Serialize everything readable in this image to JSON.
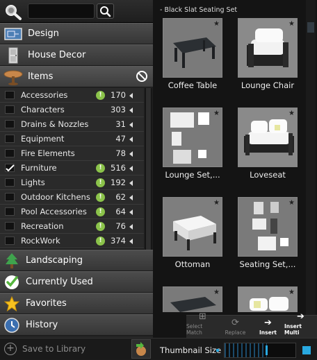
{
  "sidebar": {
    "search": {
      "value": ""
    },
    "top_categories": [
      {
        "label": "Design",
        "icon": "blueprint-icon"
      },
      {
        "label": "House Decor",
        "icon": "door-icon"
      }
    ],
    "items_category": {
      "label": "Items",
      "icon": "table-icon"
    },
    "item_list": [
      {
        "label": "Accessories",
        "count": "170",
        "alert": true,
        "checked": false
      },
      {
        "label": "Characters",
        "count": "303",
        "alert": false,
        "checked": false
      },
      {
        "label": "Drains & Nozzles",
        "count": "31",
        "alert": false,
        "checked": false
      },
      {
        "label": "Equipment",
        "count": "47",
        "alert": false,
        "checked": false
      },
      {
        "label": "Fire Elements",
        "count": "78",
        "alert": false,
        "checked": false
      },
      {
        "label": "Furniture",
        "count": "516",
        "alert": true,
        "checked": true
      },
      {
        "label": "Lights",
        "count": "192",
        "alert": true,
        "checked": false
      },
      {
        "label": "Outdoor Kitchens",
        "count": "62",
        "alert": true,
        "checked": false
      },
      {
        "label": "Pool Accessories",
        "count": "64",
        "alert": true,
        "checked": false
      },
      {
        "label": "Recreation",
        "count": "76",
        "alert": true,
        "checked": false
      },
      {
        "label": "RockWork",
        "count": "374",
        "alert": true,
        "checked": false
      }
    ],
    "bottom_categories": [
      {
        "label": "Landscaping",
        "icon": "tree-icon"
      },
      {
        "label": "Currently Used",
        "icon": "checkmark-icon"
      },
      {
        "label": "Favorites",
        "icon": "star-icon"
      },
      {
        "label": "History",
        "icon": "clock-icon"
      }
    ]
  },
  "library": {
    "section_title": "- Black Slat Seating Set",
    "items": [
      {
        "label": "Coffee Table",
        "favorite": false
      },
      {
        "label": "Lounge Chair",
        "favorite": false
      },
      {
        "label": "Lounge Set,...",
        "favorite": false
      },
      {
        "label": "Loveseat",
        "favorite": false
      },
      {
        "label": "Ottoman",
        "favorite": false
      },
      {
        "label": "Seating Set,...",
        "favorite": false
      },
      {
        "label": "",
        "favorite": false
      },
      {
        "label": "",
        "favorite": false
      }
    ]
  },
  "toolbar": {
    "select_match": "Select Match",
    "replace": "Replace",
    "insert": "Insert",
    "insert_multi": "Insert Multi"
  },
  "footer": {
    "save_to_library": "Save to Library",
    "thumbnail_size_label": "Thumbnail Size",
    "thumbnail_size_value": 0.6
  },
  "colors": {
    "accent": "#29a9e1",
    "alert": "#8bc34a"
  }
}
